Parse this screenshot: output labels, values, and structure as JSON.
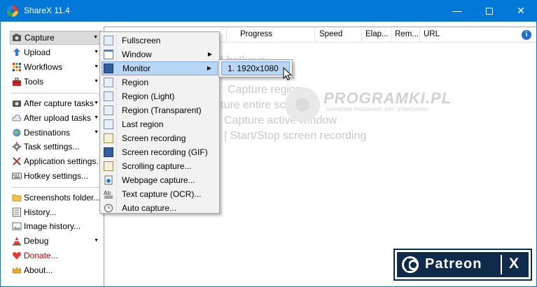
{
  "window": {
    "title": "ShareX 11.4",
    "min_glyph": "—",
    "close_glyph": "✕"
  },
  "sidebar": {
    "items": [
      {
        "label": "Capture",
        "icon": "camera-icon",
        "submenu": true,
        "active": true
      },
      {
        "label": "Upload",
        "icon": "upload-arrow-icon",
        "submenu": true
      },
      {
        "label": "Workflows",
        "icon": "workflow-grid-icon",
        "submenu": true
      },
      {
        "label": "Tools",
        "icon": "toolbox-icon",
        "submenu": true
      },
      {
        "label": "After capture tasks",
        "icon": "after-capture-icon",
        "submenu": true
      },
      {
        "label": "After upload tasks",
        "icon": "cloud-icon",
        "submenu": true
      },
      {
        "label": "Destinations",
        "icon": "destinations-icon",
        "submenu": true
      },
      {
        "label": "Task settings...",
        "icon": "gear-icon"
      },
      {
        "label": "Application settings...",
        "icon": "wrench-screwdriver-icon"
      },
      {
        "label": "Hotkey settings...",
        "icon": "keyboard-icon"
      },
      {
        "label": "Screenshots folder...",
        "icon": "folder-icon"
      },
      {
        "label": "History...",
        "icon": "history-list-icon"
      },
      {
        "label": "Image history...",
        "icon": "image-history-icon"
      },
      {
        "label": "Debug",
        "icon": "debug-cone-icon",
        "submenu": true
      },
      {
        "label": "Donate...",
        "icon": "heart-icon"
      },
      {
        "label": "About...",
        "icon": "about-crown-icon"
      }
    ],
    "arrow": "▼"
  },
  "columns": [
    "Progress",
    "Speed",
    "Elap...",
    "Rem...",
    "URL"
  ],
  "info_glyph": "i",
  "hints": [
    "d hotkeys:",
    "Capture region",
    "ture entire screen",
    "Capture active window",
    "|  Start/Stop screen recording"
  ],
  "watermark": {
    "title": "PROGRAMKI.PL",
    "subtitle": "DARMOWE PROGRAMY, GRY, STEROWNIKI"
  },
  "capture_menu": {
    "items": [
      {
        "label": "Fullscreen",
        "icon": "fullscreen-icon"
      },
      {
        "label": "Window",
        "icon": "window-icon",
        "submenu": true
      },
      {
        "label": "Monitor",
        "icon": "monitor-icon",
        "submenu": true,
        "highlighted": true
      },
      {
        "label": "Region",
        "icon": "region-icon"
      },
      {
        "label": "Region (Light)",
        "icon": "region-light-icon"
      },
      {
        "label": "Region (Transparent)",
        "icon": "region-transparent-icon"
      },
      {
        "label": "Last region",
        "icon": "last-region-icon"
      },
      {
        "label": "Screen recording",
        "icon": "screen-recording-icon"
      },
      {
        "label": "Screen recording (GIF)",
        "icon": "gif-recording-icon"
      },
      {
        "label": "Scrolling capture...",
        "icon": "scrolling-capture-icon"
      },
      {
        "label": "Webpage capture...",
        "icon": "webpage-capture-icon"
      },
      {
        "label": "Text capture (OCR)...",
        "icon": "ocr-icon"
      },
      {
        "label": "Auto capture...",
        "icon": "clock-icon"
      }
    ],
    "arrow": "▶"
  },
  "monitor_submenu": {
    "items": [
      "1. 1920x1080"
    ]
  },
  "patreon": {
    "text": "Patreon",
    "x": "X"
  }
}
